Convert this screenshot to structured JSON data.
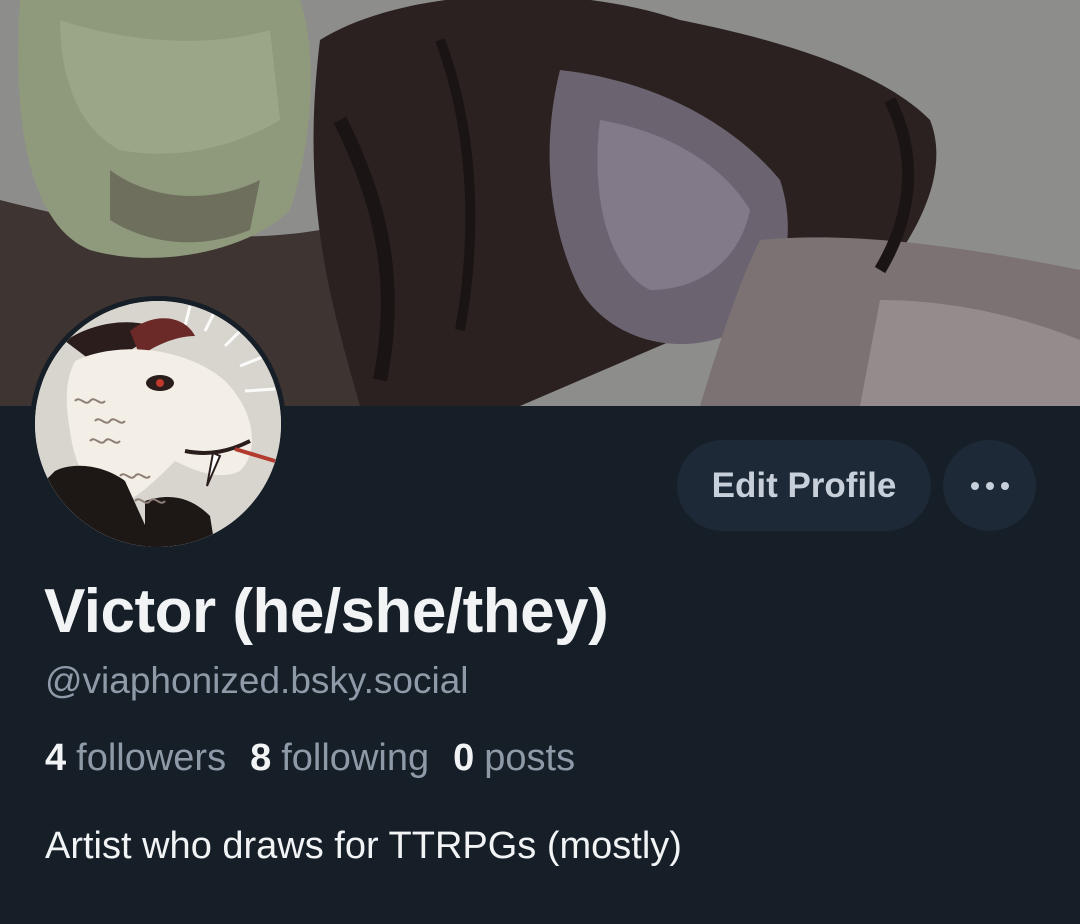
{
  "profile": {
    "display_name": "Victor (he/she/they)",
    "handle": "@viaphonized.bsky.social",
    "bio": "Artist who draws for TTRPGs (mostly)",
    "stats": {
      "followers_count": "4",
      "followers_label": "followers",
      "following_count": "8",
      "following_label": "following",
      "posts_count": "0",
      "posts_label": "posts"
    }
  },
  "actions": {
    "edit_profile_label": "Edit Profile",
    "more_icon": "more-horizontal-icon"
  },
  "colors": {
    "background": "#161e27",
    "button_bg": "#1e2937",
    "text_primary": "#f1f3f5",
    "text_secondary": "#8e9aa8"
  }
}
